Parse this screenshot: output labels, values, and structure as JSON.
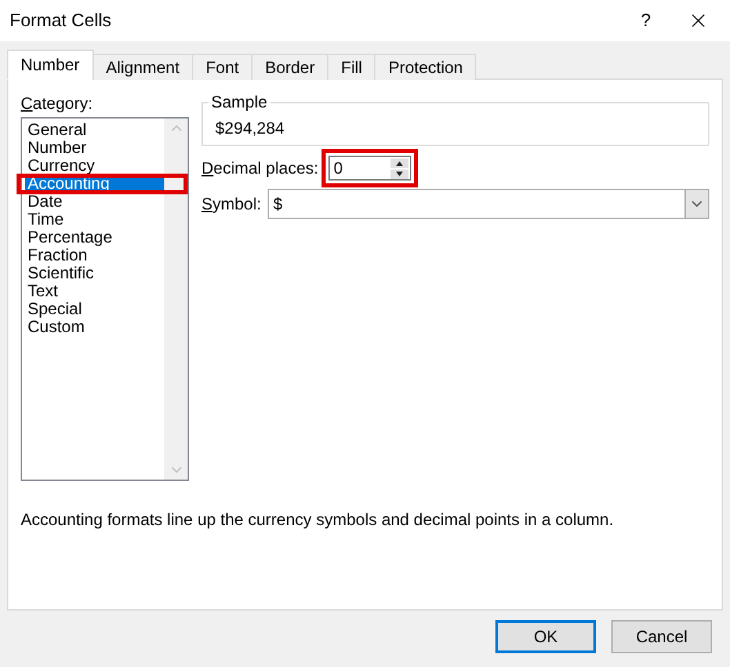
{
  "window": {
    "title": "Format Cells",
    "help": "?"
  },
  "tabs": [
    {
      "label": "Number",
      "selected": true
    },
    {
      "label": "Alignment",
      "selected": false
    },
    {
      "label": "Font",
      "selected": false
    },
    {
      "label": "Border",
      "selected": false
    },
    {
      "label": "Fill",
      "selected": false
    },
    {
      "label": "Protection",
      "selected": false
    }
  ],
  "category": {
    "label": "Category:",
    "items": [
      {
        "label": "General",
        "selected": false,
        "highlighted": false
      },
      {
        "label": "Number",
        "selected": false,
        "highlighted": false
      },
      {
        "label": "Currency",
        "selected": false,
        "highlighted": false
      },
      {
        "label": "Accounting",
        "selected": true,
        "highlighted": true
      },
      {
        "label": "Date",
        "selected": false,
        "highlighted": false
      },
      {
        "label": "Time",
        "selected": false,
        "highlighted": false
      },
      {
        "label": "Percentage",
        "selected": false,
        "highlighted": false
      },
      {
        "label": "Fraction",
        "selected": false,
        "highlighted": false
      },
      {
        "label": "Scientific",
        "selected": false,
        "highlighted": false
      },
      {
        "label": "Text",
        "selected": false,
        "highlighted": false
      },
      {
        "label": "Special",
        "selected": false,
        "highlighted": false
      },
      {
        "label": "Custom",
        "selected": false,
        "highlighted": false
      }
    ]
  },
  "sample": {
    "label": "Sample",
    "value": "$294,284"
  },
  "decimal_places": {
    "label": "Decimal places:",
    "value": "0",
    "highlighted": true
  },
  "symbol": {
    "label": "Symbol:",
    "value": "$"
  },
  "description": "Accounting formats line up the currency symbols and decimal points in a column.",
  "buttons": [
    {
      "label": "OK",
      "default": true
    },
    {
      "label": "Cancel",
      "default": false
    }
  ]
}
